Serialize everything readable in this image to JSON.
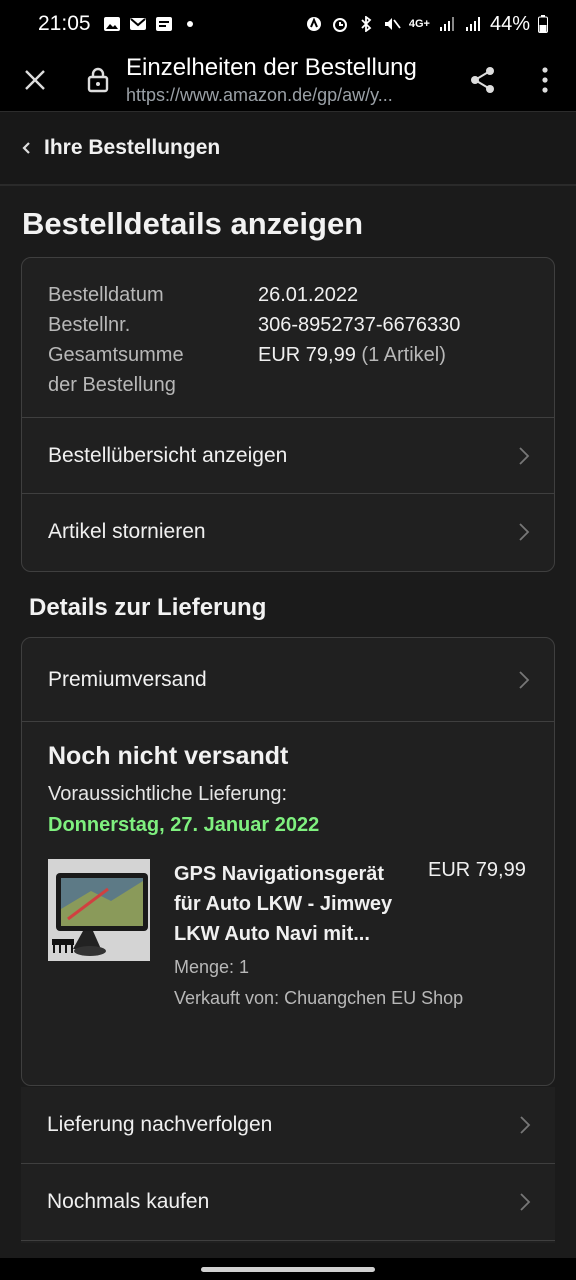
{
  "status_bar": {
    "time": "21:05",
    "battery_percent": "44%",
    "network_label": "4G+"
  },
  "browser": {
    "title": "Einzelheiten der Bestellung",
    "url": "https://www.amazon.de/gp/aw/y..."
  },
  "back_nav": {
    "label": "Ihre Bestellungen"
  },
  "page": {
    "title": "Bestelldetails anzeigen"
  },
  "order": {
    "date_label": "Bestelldatum",
    "date_value": "26.01.2022",
    "number_label": "Bestellnr.",
    "number_value": "306-8952737-6676330",
    "total_label_line1": "Gesamtsumme",
    "total_label_line2": "der Bestellung",
    "total_value": "EUR 79,99",
    "total_items": "(1 Artikel)",
    "overview_link": "Bestellübersicht anzeigen",
    "cancel_link": "Artikel stornieren"
  },
  "delivery": {
    "section_title": "Details zur Lieferung",
    "shipping_method": "Premiumversand",
    "status": "Noch nicht versandt",
    "estimate_label": "Voraussichtliche Lieferung:",
    "estimate_date": "Donnerstag, 27. Januar 2022",
    "product": {
      "name": "GPS Navigationsgerät für Auto LKW - Jimwey LKW Auto Navi mit...",
      "price": "EUR 79,99",
      "quantity": "Menge: 1",
      "seller": "Verkauft von: Chuangchen EU Shop"
    }
  },
  "actions": {
    "track": "Lieferung nachverfolgen",
    "buy_again": "Nochmals kaufen"
  },
  "colors": {
    "delivery_date_green": "#7ff07f",
    "background": "#1b1b1b",
    "card_border": "#3f3f3f"
  }
}
